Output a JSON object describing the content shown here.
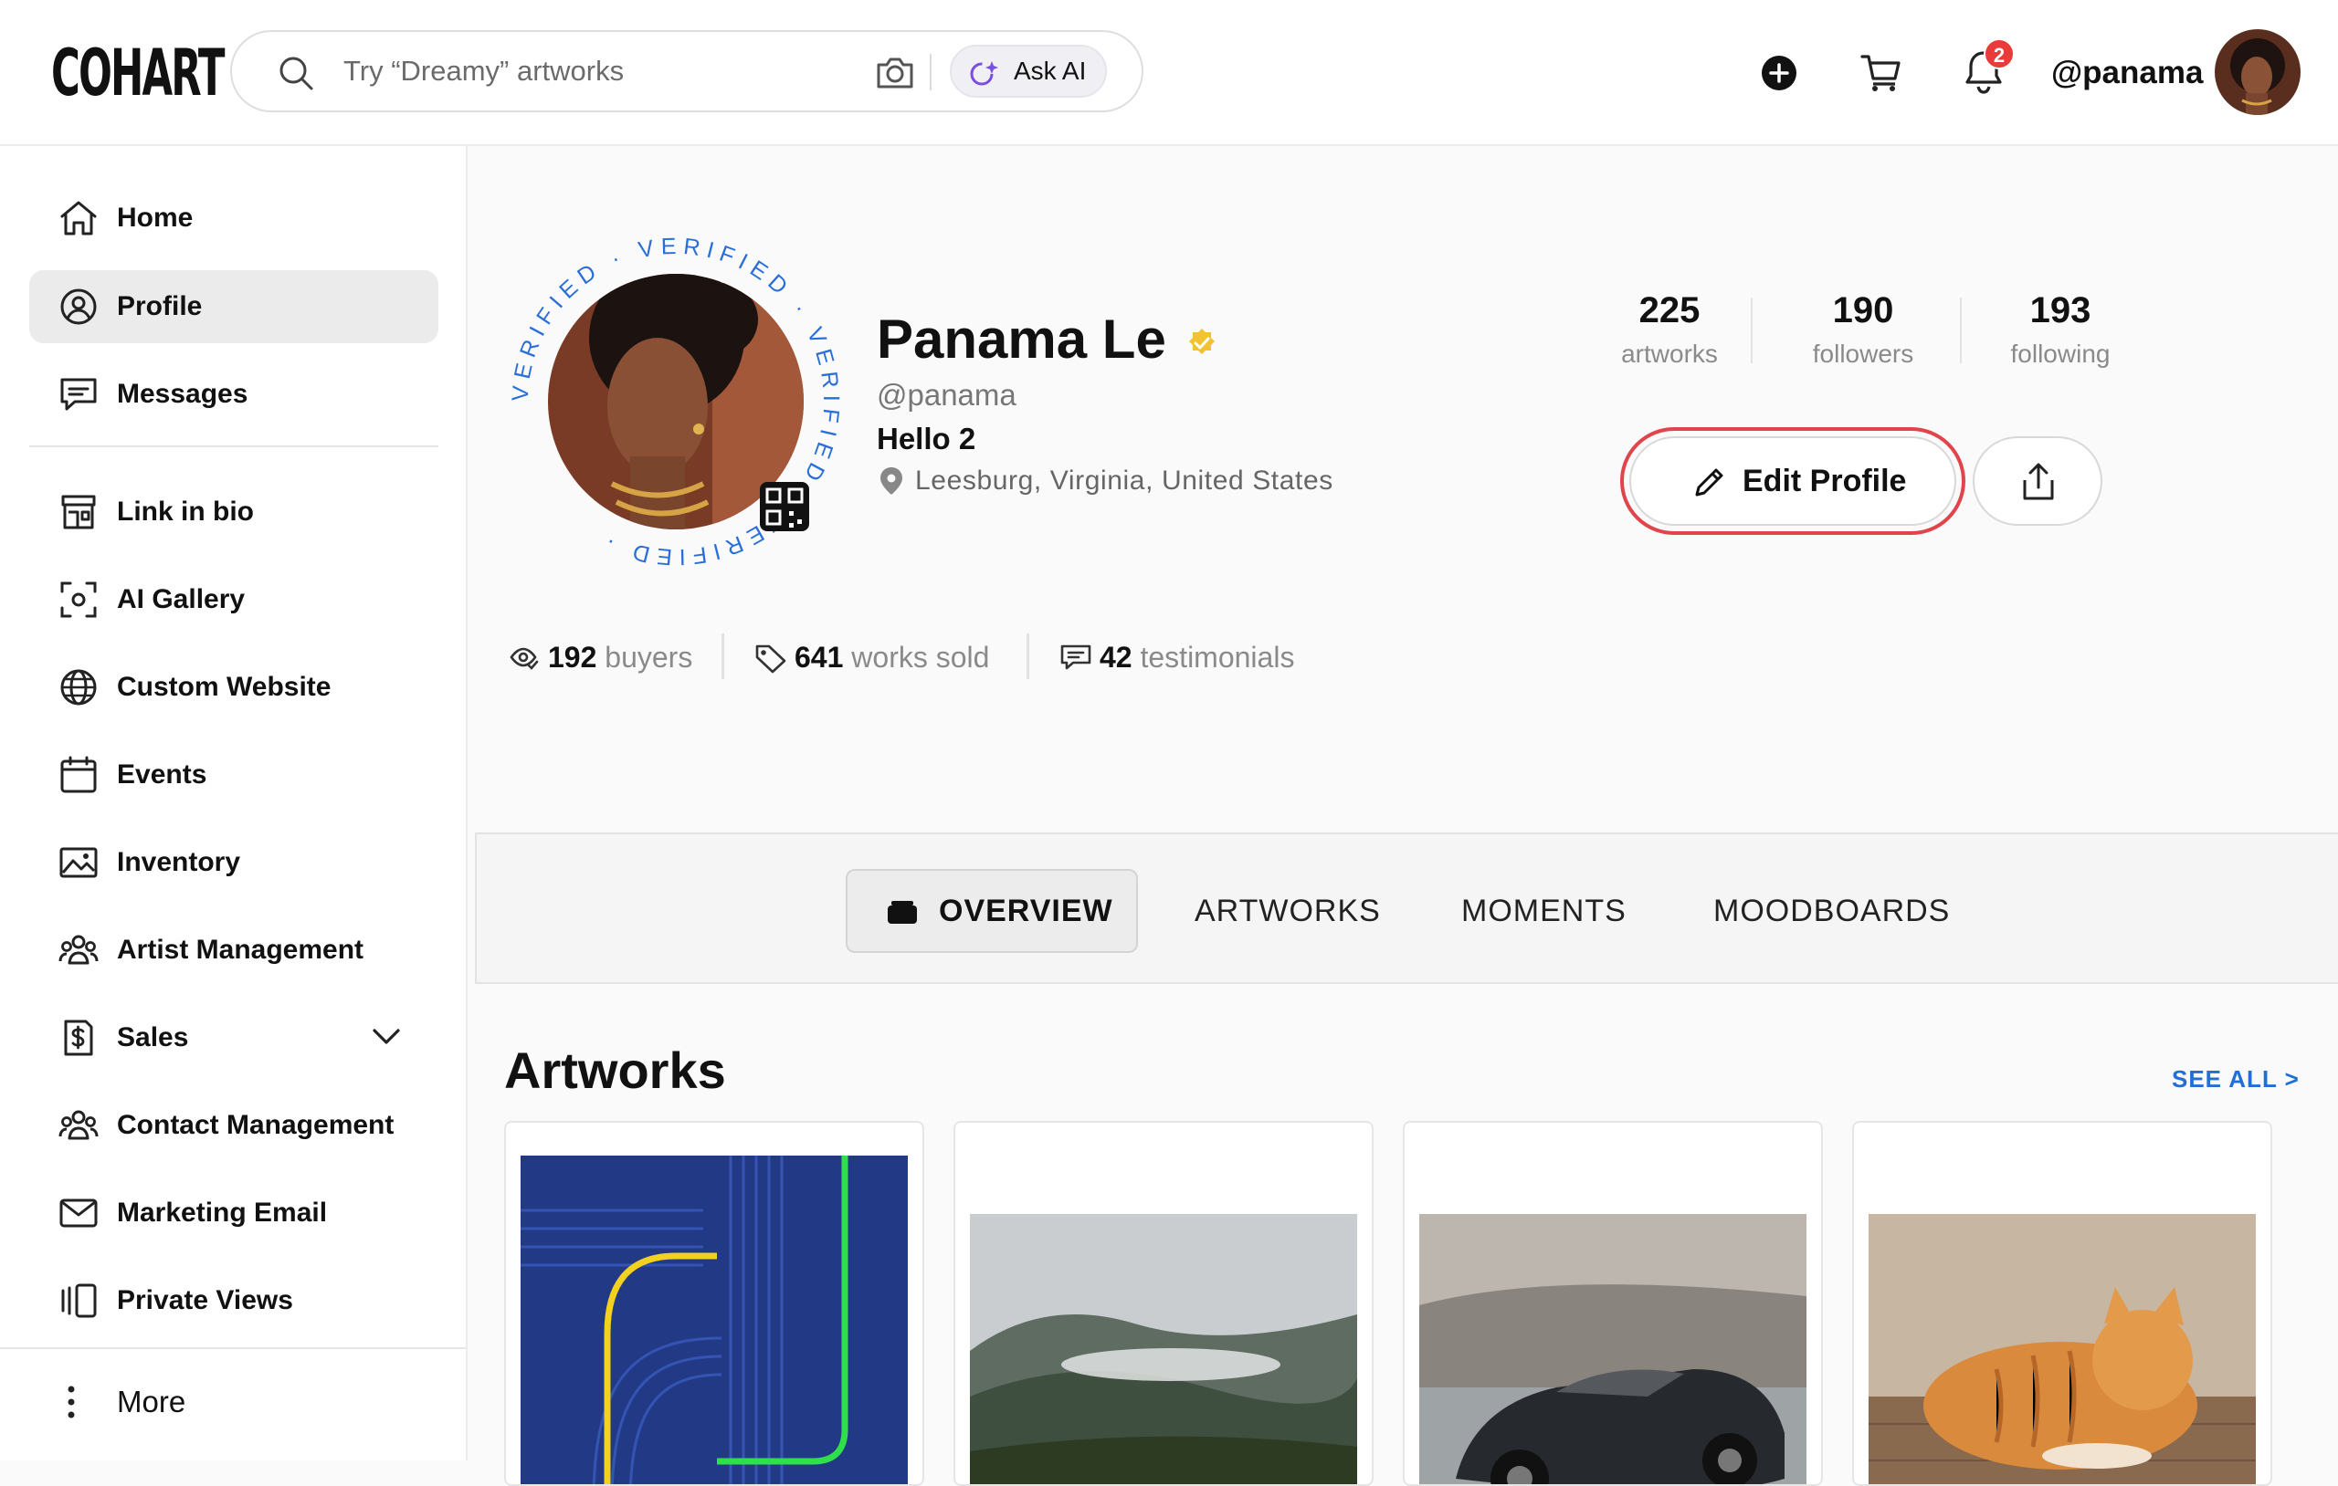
{
  "header": {
    "logo": "COHART",
    "search_placeholder": "Try “Dreamy” artworks",
    "ask_ai_label": "Ask AI",
    "notifications_count": "2",
    "username": "@panama"
  },
  "sidebar": {
    "items": [
      {
        "label": "Home",
        "icon": "home-icon"
      },
      {
        "label": "Profile",
        "icon": "profile-icon",
        "active": true
      },
      {
        "label": "Messages",
        "icon": "messages-icon"
      },
      {
        "label": "Link in bio",
        "icon": "storefront-icon"
      },
      {
        "label": "AI Gallery",
        "icon": "ai-gallery-icon"
      },
      {
        "label": "Custom Website",
        "icon": "globe-icon"
      },
      {
        "label": "Events",
        "icon": "calendar-icon"
      },
      {
        "label": "Inventory",
        "icon": "image-icon"
      },
      {
        "label": "Artist Management",
        "icon": "people-icon"
      },
      {
        "label": "Sales",
        "icon": "dollar-icon"
      },
      {
        "label": "Contact Management",
        "icon": "contacts-icon"
      },
      {
        "label": "Marketing Email",
        "icon": "mail-icon"
      },
      {
        "label": "Private Views",
        "icon": "private-views-icon"
      }
    ],
    "more_label": "More"
  },
  "profile": {
    "name": "Panama Le",
    "handle": "@panama",
    "bio": "Hello 2",
    "location": "Leesburg, Virginia, United States",
    "verified_ring_text": "VERIFIED · VERIFIED · VERIFIED · VERIFIED · ",
    "stats": [
      {
        "num": "225",
        "cap": "artworks"
      },
      {
        "num": "190",
        "cap": "followers"
      },
      {
        "num": "193",
        "cap": "following"
      }
    ],
    "edit_label": "Edit Profile",
    "metrics": [
      {
        "num": "192",
        "label": "buyers"
      },
      {
        "num": "641",
        "label": "works sold"
      },
      {
        "num": "42",
        "label": "testimonials"
      }
    ]
  },
  "tabs": [
    {
      "label": "OVERVIEW",
      "active": true
    },
    {
      "label": "ARTWORKS"
    },
    {
      "label": "MOMENTS"
    },
    {
      "label": "MOODBOARDS"
    }
  ],
  "artworks": {
    "title": "Artworks",
    "see_all": "SEE ALL >"
  },
  "colors": {
    "accent_link": "#1f6fd6",
    "verified": "#f2c230",
    "edit_ring": "#e0454c",
    "badge": "#ea3b3b"
  }
}
